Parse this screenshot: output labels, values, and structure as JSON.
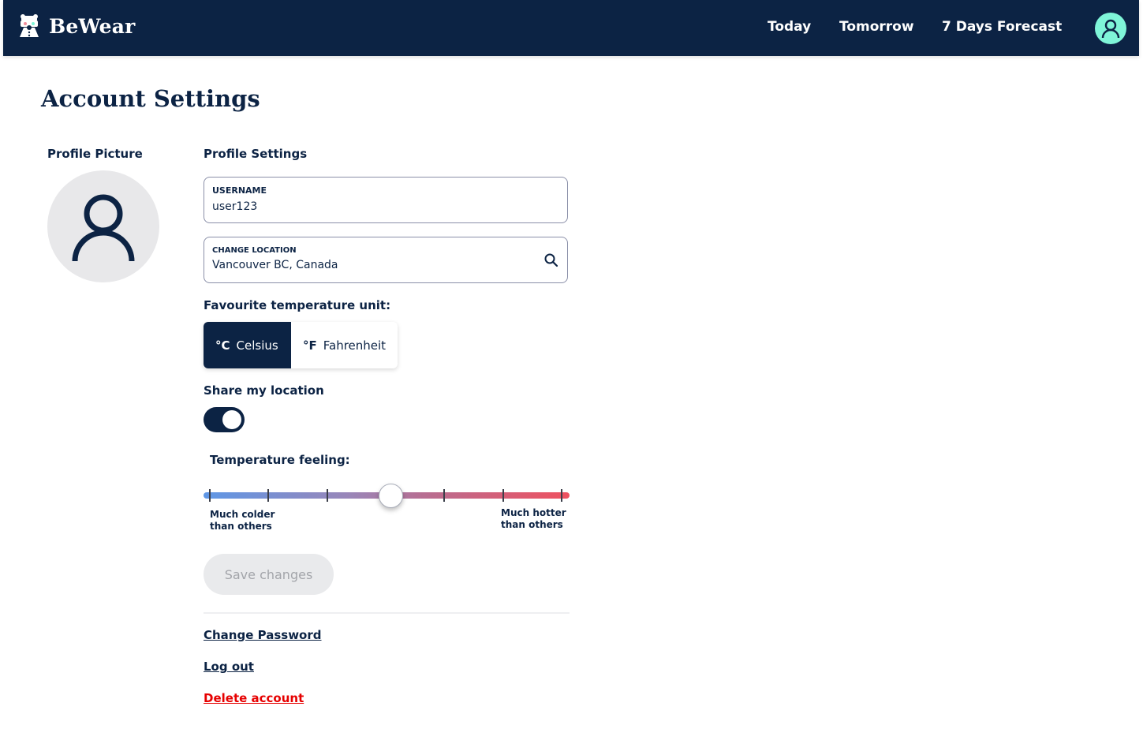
{
  "app": {
    "brand_name": "BeWear",
    "colors": {
      "primary": "#0c2344",
      "accent": "#7ff5d8",
      "danger": "#e60000",
      "disabled_bg": "#e9eaec"
    }
  },
  "nav": {
    "items": [
      {
        "label": "Today"
      },
      {
        "label": "Tomorrow"
      },
      {
        "label": "7 Days Forecast"
      }
    ],
    "account_icon": "user-circle-icon"
  },
  "page": {
    "title": "Account Settings",
    "profile_picture_label": "Profile Picture",
    "profile_settings_label": "Profile Settings"
  },
  "form": {
    "username": {
      "label": "USERNAME",
      "value": "user123"
    },
    "location": {
      "label": "CHANGE LOCATION",
      "value": "Vancouver BC, Canada",
      "icon": "search-icon"
    },
    "temperature_unit": {
      "label": "Favourite temperature unit:",
      "options": [
        {
          "symbol": "°C",
          "label": "Celsius",
          "selected": true
        },
        {
          "symbol": "°F",
          "label": "Fahrenheit",
          "selected": false
        }
      ]
    },
    "share_location": {
      "label": "Share my location",
      "enabled": true
    },
    "temperature_feeling": {
      "label": "Temperature feeling:",
      "steps": 7,
      "selected_index": 3,
      "min_label": "Much colder than others",
      "max_label": "Much hotter than others"
    },
    "save_label": "Save changes",
    "save_disabled": true
  },
  "links": {
    "change_password": "Change Password",
    "log_out": "Log out",
    "delete_account": "Delete account"
  }
}
